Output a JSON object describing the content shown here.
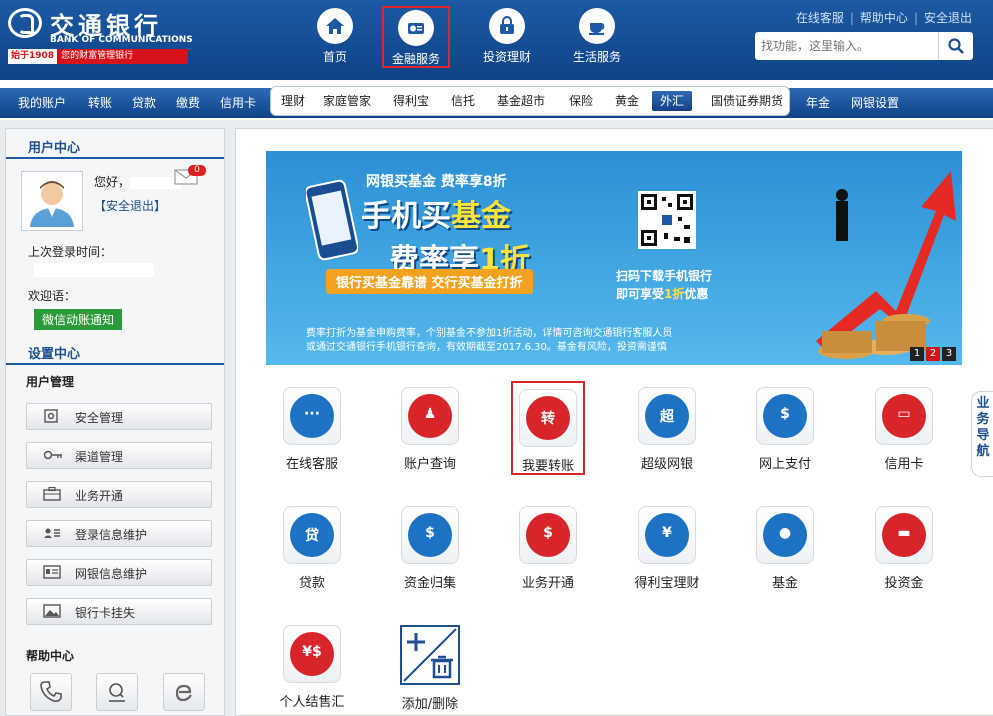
{
  "logo": {
    "cn": "交通银行",
    "en": "BANK OF COMMUNICATIONS",
    "since": "始于1908",
    "slogan": "您的财富管理银行"
  },
  "top_nav": [
    {
      "label": "首页",
      "icon": "home-icon",
      "active": false
    },
    {
      "label": "金融服务",
      "icon": "finance-icon",
      "active": true
    },
    {
      "label": "投资理财",
      "icon": "lock-bag-icon",
      "active": false
    },
    {
      "label": "生活服务",
      "icon": "coffee-icon",
      "active": false
    }
  ],
  "util_links": [
    "在线客服",
    "帮助中心",
    "安全退出"
  ],
  "search": {
    "placeholder": "找功能，这里输入。"
  },
  "main_nav": [
    "我的账户",
    "转账",
    "贷款",
    "缴费",
    "信用卡"
  ],
  "sub_nav": [
    "理财",
    "家庭管家",
    "得利宝",
    "信托",
    "基金超市",
    "保险",
    "黄金",
    "外汇",
    "国债证券期货"
  ],
  "sub_nav_active": "外汇",
  "main_nav_right": [
    "年金",
    "网银设置"
  ],
  "user_center": {
    "title": "用户中心",
    "greeting": "您好，",
    "mail_count": "0",
    "logout": "【安全退出】",
    "last_login_label": "上次登录时间：",
    "welcome_label": "欢迎语：",
    "wechat_btn": "微信动账通知"
  },
  "settings": {
    "title": "设置中心",
    "user_mgmt": "用户管理",
    "items": [
      {
        "label": "安全管理",
        "icon": "safe-icon"
      },
      {
        "label": "渠道管理",
        "icon": "key-icon"
      },
      {
        "label": "业务开通",
        "icon": "briefcase-icon"
      },
      {
        "label": "登录信息维护",
        "icon": "user-card-icon"
      },
      {
        "label": "网银信息维护",
        "icon": "id-card-icon"
      },
      {
        "label": "银行卡挂失",
        "icon": "card-image-icon"
      }
    ],
    "help_title": "帮助中心"
  },
  "banner": {
    "line1": "网银买基金  费率享8折",
    "line2a": "手机买",
    "line2b": "基金",
    "line2c": "费率享",
    "line2d": "1折",
    "line3": "银行买基金靠谱  交行买基金打折",
    "scan1": "扫码下载手机银行",
    "scan2a": "即可享受",
    "scan2b": "1折",
    "scan2c": "优惠",
    "note1": "费率打折为基金申购费率，个别基金不参加1折活动，详情可咨询交通银行客服人员",
    "note2": "或通过交通银行手机银行查询，有效期截至2017.6.30。基金有风险，投资需谨慎",
    "pages": [
      "1",
      "2",
      "3"
    ],
    "current_page": "2"
  },
  "services": [
    {
      "name": "在线客服",
      "glyph": "···",
      "color": "#1e72c4"
    },
    {
      "name": "账户查询",
      "glyph": "♟",
      "color": "#d8242b"
    },
    {
      "name": "我要转账",
      "glyph": "转",
      "color": "#d8242b",
      "active": true
    },
    {
      "name": "超级网银",
      "glyph": "超",
      "color": "#1e72c4"
    },
    {
      "name": "网上支付",
      "glyph": "$",
      "color": "#1e72c4"
    },
    {
      "name": "信用卡",
      "glyph": "▭",
      "color": "#d8242b"
    },
    {
      "name": "贷款",
      "glyph": "贷",
      "color": "#1e72c4"
    },
    {
      "name": "资金归集",
      "glyph": "$",
      "color": "#1e72c4"
    },
    {
      "name": "业务开通",
      "glyph": "$",
      "color": "#d8242b"
    },
    {
      "name": "得利宝理财",
      "glyph": "¥",
      "color": "#1e72c4"
    },
    {
      "name": "基金",
      "glyph": "●",
      "color": "#1e72c4"
    },
    {
      "name": "投资金",
      "glyph": "▬",
      "color": "#d8242b"
    },
    {
      "name": "个人结售汇",
      "glyph": "¥$",
      "color": "#d8242b"
    },
    {
      "name": "添加/删除",
      "glyph": "",
      "color": "#ffffff"
    }
  ],
  "side_tab": "业务导航"
}
